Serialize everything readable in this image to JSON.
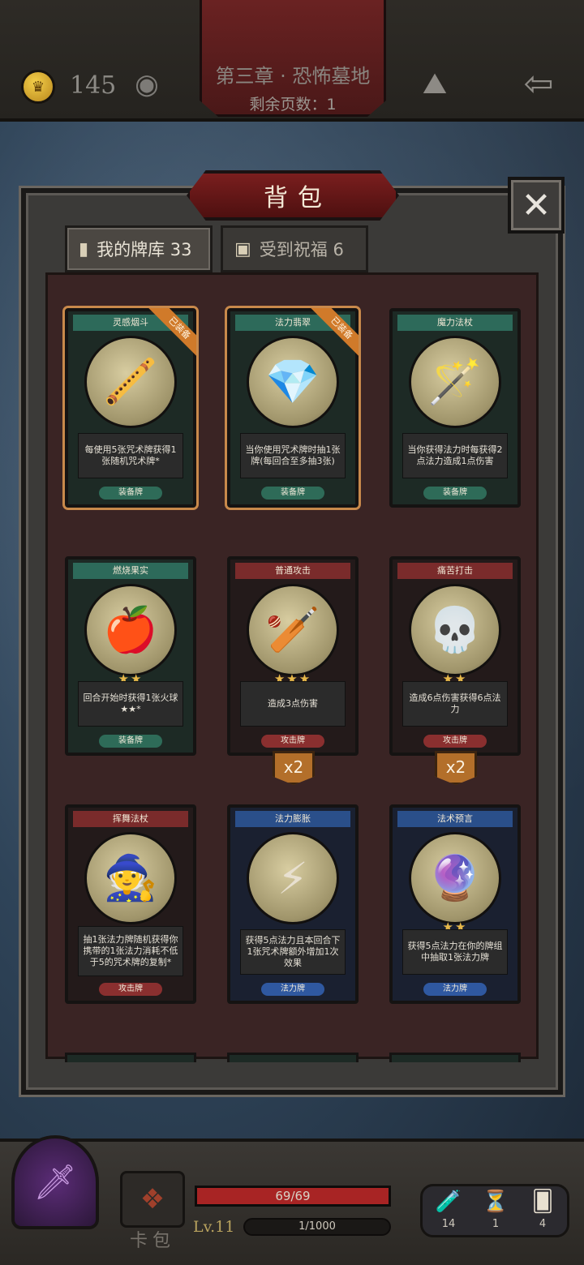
{
  "top": {
    "coins": "145",
    "chapter_title": "第三章 · 恐怖墓地",
    "pages_left": "剩余页数：1"
  },
  "backpack": {
    "title": "背包",
    "close_label": "✕",
    "tabs": [
      {
        "label": "我的牌库 33",
        "icon": "card-icon"
      },
      {
        "label": "受到祝福 6",
        "icon": "gift-icon"
      }
    ],
    "cards": [
      {
        "name": "灵感烟斗",
        "desc": "每使用5张咒术牌获得1张随机咒术牌*",
        "type": "装备牌",
        "color": "green",
        "equipped": "已装备",
        "stars": "",
        "icon": "pipe-icon",
        "art": "🪈"
      },
      {
        "name": "法力翡翠",
        "desc": "当你使用咒术牌时抽1张牌(每回合至多抽3张)",
        "type": "装备牌",
        "color": "green",
        "equipped": "已装备",
        "stars": "",
        "icon": "crystal-icon",
        "art": "💎"
      },
      {
        "name": "魔力法杖",
        "desc": "当你获得法力时每获得2点法力造成1点伤害",
        "type": "装备牌",
        "color": "green",
        "equipped": "",
        "stars": "",
        "icon": "staff-icon",
        "art": "🪄"
      },
      {
        "name": "燃烧果实",
        "desc": "回合开始时获得1张火球★★*",
        "type": "装备牌",
        "color": "green",
        "equipped": "",
        "stars": "★★",
        "icon": "fruit-icon",
        "art": "🍎"
      },
      {
        "name": "普通攻击",
        "desc": "造成3点伤害",
        "type": "攻击牌",
        "color": "red",
        "equipped": "",
        "stars": "★★★",
        "icon": "club-icon",
        "art": "🏏"
      },
      {
        "name": "痛苦打击",
        "desc": "造成6点伤害获得6点法力",
        "type": "攻击牌",
        "color": "red",
        "equipped": "",
        "stars": "★★",
        "icon": "skull-strike-icon",
        "art": "💀"
      },
      {
        "name": "挥舞法杖",
        "desc": "抽1张法力牌随机获得你携带的1张法力消耗不低于5的咒术牌的复制*",
        "type": "攻击牌",
        "color": "red",
        "equipped": "",
        "stars": "",
        "icon": "witch-icon",
        "art": "🧙"
      },
      {
        "name": "法力膨胀",
        "desc": "获得5点法力且本回合下1张咒术牌额外增加1次效果",
        "type": "法力牌",
        "color": "blue",
        "equipped": "",
        "stars": "",
        "icon": "lightning-icon",
        "art": "⚡"
      },
      {
        "name": "法术预言",
        "desc": "获得5点法力在你的牌组中抽取1张法力牌",
        "type": "法力牌",
        "color": "blue",
        "equipped": "",
        "stars": "★★",
        "icon": "orb-icon",
        "art": "🔮"
      }
    ],
    "multipliers": [
      "x2",
      "x2"
    ]
  },
  "bottom": {
    "bag_label": "卡包",
    "hp_text": "69/69",
    "hp_fraction": 1.0,
    "level": "Lv.11",
    "xp_text": "1/1000",
    "resources": [
      {
        "icon": "potion-icon",
        "glyph": "🧪",
        "count": "14"
      },
      {
        "icon": "hourglass-icon",
        "glyph": "⏳",
        "count": "1"
      },
      {
        "icon": "cards-icon",
        "glyph": "🂠",
        "count": "4"
      }
    ]
  }
}
